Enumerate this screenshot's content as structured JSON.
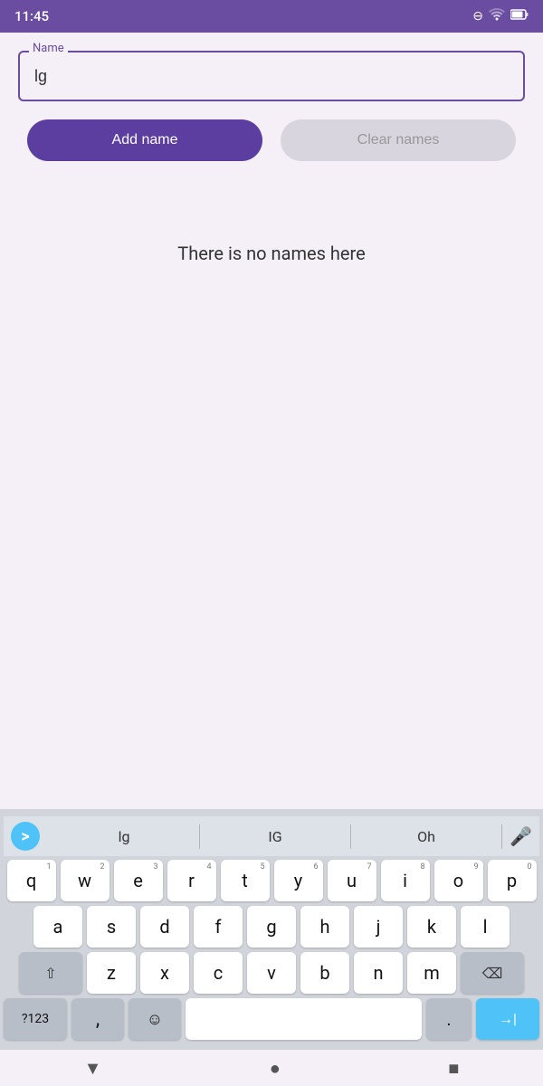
{
  "status": {
    "time": "11:45",
    "sync_icon": "⊖",
    "wifi_icon": "▼",
    "battery_icon": "🔋"
  },
  "form": {
    "input_label": "Name",
    "input_value": "lg",
    "input_placeholder": ""
  },
  "buttons": {
    "add_label": "Add name",
    "clear_label": "Clear names"
  },
  "empty_state": {
    "message": "There is no names here"
  },
  "keyboard": {
    "suggestions": [
      "lg",
      "lG",
      "Oh"
    ],
    "rows": [
      [
        {
          "key": "q",
          "num": "1"
        },
        {
          "key": "w",
          "num": "2"
        },
        {
          "key": "e",
          "num": "3"
        },
        {
          "key": "r",
          "num": "4"
        },
        {
          "key": "t",
          "num": "5"
        },
        {
          "key": "y",
          "num": "6"
        },
        {
          "key": "u",
          "num": "7"
        },
        {
          "key": "i",
          "num": "8"
        },
        {
          "key": "o",
          "num": "9"
        },
        {
          "key": "p",
          "num": "0"
        }
      ],
      [
        {
          "key": "a"
        },
        {
          "key": "s"
        },
        {
          "key": "d"
        },
        {
          "key": "f"
        },
        {
          "key": "g"
        },
        {
          "key": "h"
        },
        {
          "key": "j"
        },
        {
          "key": "k"
        },
        {
          "key": "l"
        }
      ],
      [
        {
          "key": "z"
        },
        {
          "key": "x"
        },
        {
          "key": "c"
        },
        {
          "key": "v"
        },
        {
          "key": "b"
        },
        {
          "key": "n"
        },
        {
          "key": "m"
        }
      ]
    ],
    "sym_label": "?123",
    "comma_label": ",",
    "emoji_label": "☺",
    "period_label": ".",
    "enter_label": "→|"
  },
  "nav": {
    "back_icon": "▼",
    "home_icon": "●",
    "recents_icon": "■"
  }
}
